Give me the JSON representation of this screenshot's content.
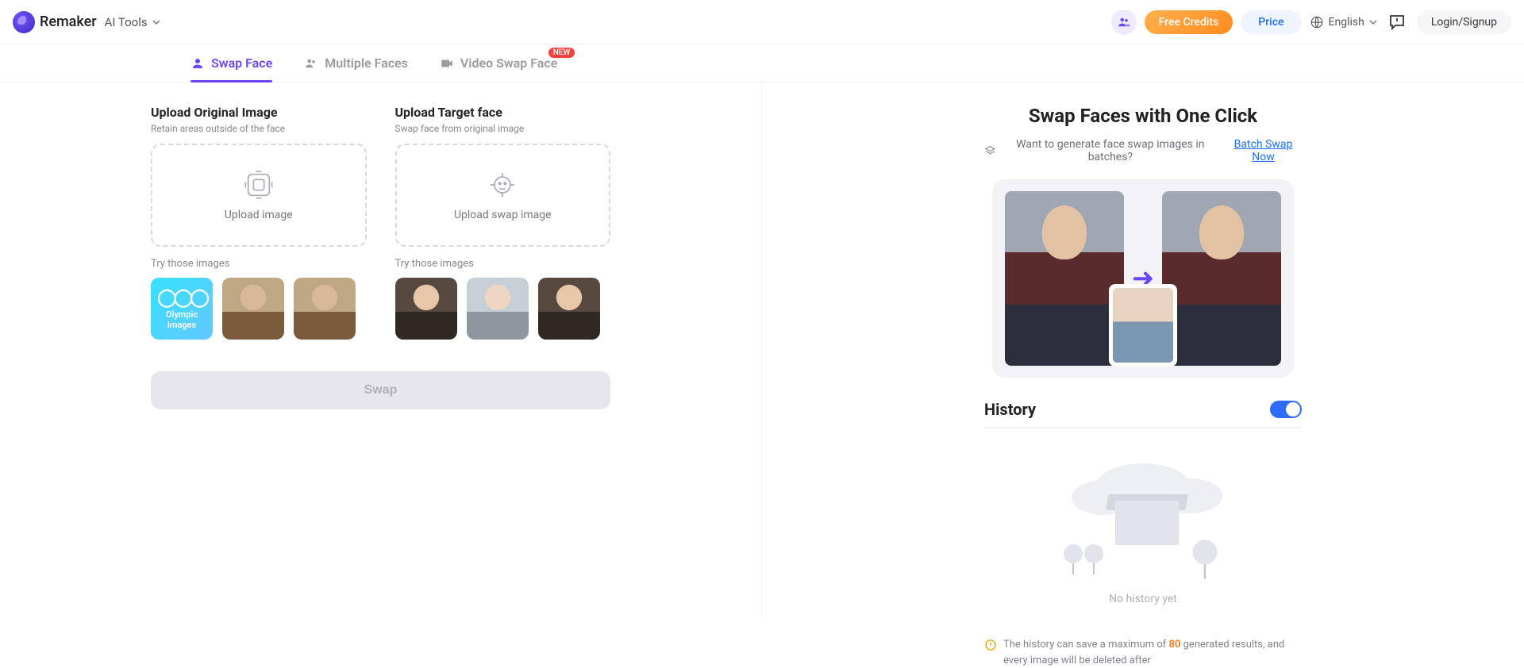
{
  "header": {
    "brand": "Remaker",
    "ai_tools": "AI Tools",
    "free_credits": "Free Credits",
    "price": "Price",
    "language": "English",
    "login": "Login/Signup"
  },
  "tabs": {
    "swap_face": "Swap Face",
    "multiple_faces": "Multiple Faces",
    "video_swap_face": "Video Swap Face",
    "new_badge": "NEW"
  },
  "upload_original": {
    "title": "Upload Original Image",
    "subtitle": "Retain areas outside of the face",
    "drop_label": "Upload image",
    "try_label": "Try those images",
    "samples": {
      "olympic_text": "Olympic Images"
    }
  },
  "upload_target": {
    "title": "Upload Target face",
    "subtitle": "Swap face from original image",
    "drop_label": "Upload swap image",
    "try_label": "Try those images"
  },
  "swap_button": "Swap",
  "right": {
    "title": "Swap Faces with One Click",
    "batch_text": "Want to generate face swap images in batches?",
    "batch_link": "Batch Swap Now",
    "history_label": "History",
    "empty_text": "No history yet",
    "notice_prefix": "The history can save a maximum of ",
    "notice_max": "80",
    "notice_suffix": " generated results, and every image will be deleted after"
  }
}
